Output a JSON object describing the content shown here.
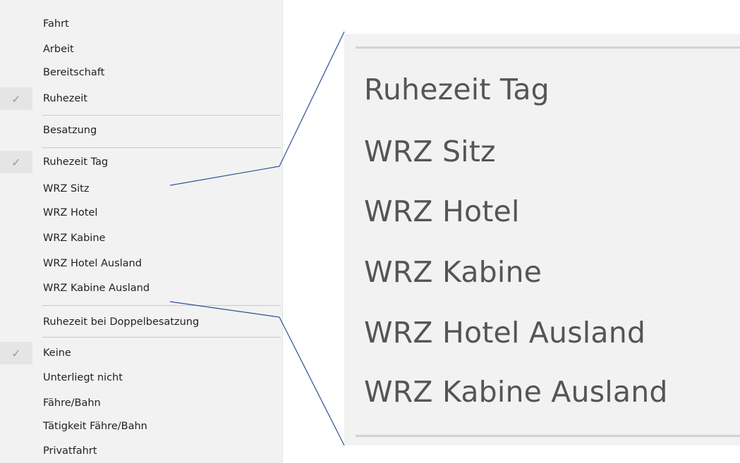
{
  "menu": {
    "group_activity": [
      {
        "label": "Fahrt",
        "checked": false
      },
      {
        "label": "Arbeit",
        "checked": false
      },
      {
        "label": "Bereitschaft",
        "checked": false
      },
      {
        "label": "Ruhezeit",
        "checked": true
      }
    ],
    "crew": {
      "label": "Besatzung"
    },
    "group_rest": [
      {
        "label": "Ruhezeit Tag",
        "checked": true
      },
      {
        "label": "WRZ Sitz",
        "checked": false
      },
      {
        "label": "WRZ Hotel",
        "checked": false
      },
      {
        "label": "WRZ Kabine",
        "checked": false
      },
      {
        "label": "WRZ Hotel Ausland",
        "checked": false
      },
      {
        "label": "WRZ Kabine Ausland",
        "checked": false
      }
    ],
    "double_crew": {
      "label": "Ruhezeit bei Doppelbesatzung"
    },
    "group_type": [
      {
        "label": "Keine",
        "checked": true
      },
      {
        "label": "Unterliegt nicht",
        "checked": false
      },
      {
        "label": "Fähre/Bahn",
        "checked": false
      },
      {
        "label": "Tätigkeit Fähre/Bahn",
        "checked": false
      },
      {
        "label": "Privatfahrt",
        "checked": false
      }
    ],
    "check_glyph": "checkmark-icon"
  },
  "zoom": {
    "items": [
      "Ruhezeit Tag",
      "WRZ Sitz",
      "WRZ Hotel",
      "WRZ Kabine",
      "WRZ Hotel Ausland",
      "WRZ Kabine Ausland"
    ]
  },
  "colors": {
    "menu_background": "#f2f2f2",
    "check_highlight": "#e5e5e5",
    "check_mark": "#9a9a9a",
    "callout_line": "#2e4f96"
  }
}
